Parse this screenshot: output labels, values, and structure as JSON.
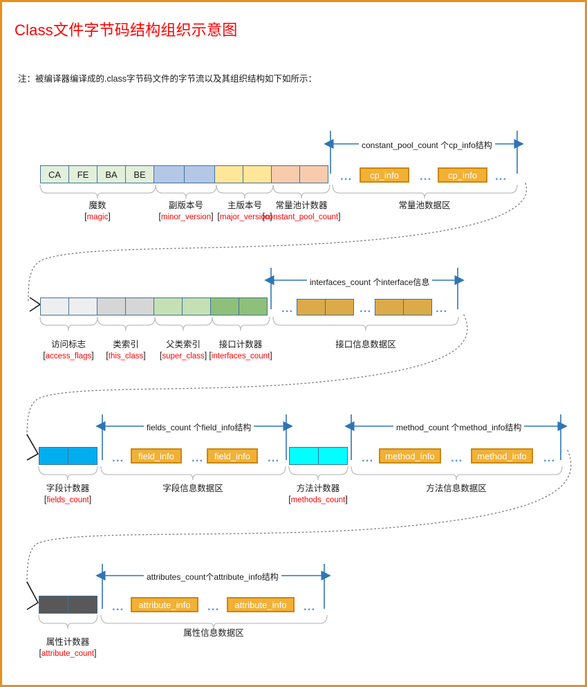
{
  "title": "Class文件字节码结构组织示意图",
  "note": "注：被编译器编译成的.class字节码文件的字节流以及其组织结构如下如所示：",
  "colors": {
    "border": "#e8901a",
    "accent_red": "#ff0000",
    "cell_stroke": "#41719c",
    "arrow_blue": "#2e75b6",
    "chip_fill": "#f2b035",
    "chip_stroke": "#c8880f",
    "brace_gray": "#bfbfbf",
    "dots_blue": "#5b9bd5",
    "magic": "#e2efda",
    "minor_version": "#b4c7e7",
    "major_version": "#ffe699",
    "constant_pool_count": "#f8cbad",
    "access_flags": "#eeeeee",
    "this_class": "#d6d6d6",
    "super_class": "#c5e0b4",
    "interfaces_count": "#8fc07a",
    "interface_cell": "#dbab4a",
    "fields_count": "#00aeef",
    "methods_count": "#00ffff",
    "attribute_count": "#585858"
  },
  "rows": [
    {
      "name": "row-constant-pool",
      "bytes": [
        {
          "text": "CA",
          "group": "magic"
        },
        {
          "text": "FE",
          "group": "magic"
        },
        {
          "text": "BA",
          "group": "magic"
        },
        {
          "text": "BE",
          "group": "magic"
        },
        {
          "text": "",
          "group": "minor_version"
        },
        {
          "text": "",
          "group": "minor_version"
        },
        {
          "text": "",
          "group": "major_version"
        },
        {
          "text": "",
          "group": "major_version"
        },
        {
          "text": "",
          "group": "constant_pool_count"
        },
        {
          "text": "",
          "group": "constant_pool_count"
        }
      ],
      "span_caption": "constant_pool_count 个cp_info结构",
      "chips": [
        "cp_info",
        "cp_info"
      ],
      "labels": [
        {
          "cn": "魔数",
          "code": "magic"
        },
        {
          "cn": "副版本号",
          "code": "minor_version"
        },
        {
          "cn": "主版本号",
          "code": "major_version"
        },
        {
          "cn": "常量池计数器",
          "code": "constant_pool_count"
        },
        {
          "cn": "常量池数据区",
          "code": ""
        }
      ]
    },
    {
      "name": "row-interfaces",
      "bytes": [
        {
          "text": "",
          "group": "access_flags"
        },
        {
          "text": "",
          "group": "access_flags"
        },
        {
          "text": "",
          "group": "this_class"
        },
        {
          "text": "",
          "group": "this_class"
        },
        {
          "text": "",
          "group": "super_class"
        },
        {
          "text": "",
          "group": "super_class"
        },
        {
          "text": "",
          "group": "interfaces_count"
        },
        {
          "text": "",
          "group": "interfaces_count"
        }
      ],
      "span_caption": "interfaces_count 个interface信息",
      "labels": [
        {
          "cn": "访问标志",
          "code": "access_flags"
        },
        {
          "cn": "类索引",
          "code": "this_class"
        },
        {
          "cn": "父类索引",
          "code": "super_class"
        },
        {
          "cn": "接口计数器",
          "code": "interfaces_count"
        },
        {
          "cn": "接口信息数据区",
          "code": ""
        }
      ]
    },
    {
      "name": "row-fields-methods",
      "span_caption_fields": "fields_count 个field_info结构",
      "span_caption_methods": "method_count 个method_info结构",
      "chips_fields": [
        "field_info",
        "field_info"
      ],
      "chips_methods": [
        "method_info",
        "method_info"
      ],
      "labels": [
        {
          "cn": "字段计数器",
          "code": "fields_count"
        },
        {
          "cn": "字段信息数据区",
          "code": ""
        },
        {
          "cn": "方法计数器",
          "code": "methods_count"
        },
        {
          "cn": "方法信息数据区",
          "code": ""
        }
      ]
    },
    {
      "name": "row-attributes",
      "span_caption": "attributes_count个attribute_info结构",
      "chips": [
        "attribute_info",
        "attribute_info"
      ],
      "labels": [
        {
          "cn": "属性计数器",
          "code": "attribute_count"
        },
        {
          "cn": "属性信息数据区",
          "code": ""
        }
      ]
    }
  ],
  "ellipsis": "..."
}
